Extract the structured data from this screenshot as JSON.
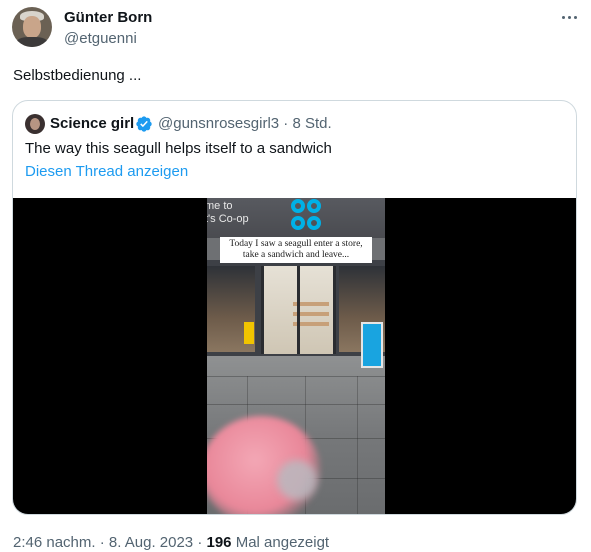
{
  "author": {
    "name": "Günter Born",
    "handle": "@etguenni"
  },
  "tweet": {
    "text": "Selbstbedienung ..."
  },
  "quoted_tweet": {
    "name": "Science girl",
    "handle_time": "@gunsnrosesgirl3 · 8 Std.",
    "text": "The way this seagull helps itself to a sandwich",
    "show_thread_link": "Diesen Thread anzeigen",
    "verified_color": "#1d9bf0",
    "video_frame": {
      "sign_text_line1": "me to",
      "sign_text_line2": "t's Co-op",
      "caption_line1": "Today I saw a seagull enter a store,",
      "caption_line2": "take a sandwich and leave..."
    }
  },
  "footer": {
    "time": "2:46 nachm.",
    "separator1": " · ",
    "date": "8. Aug. 2023",
    "separator2": " · ",
    "views_count": "196",
    "views_label": " Mal angezeigt"
  },
  "icons": {
    "more": "more-horizontal-icon",
    "verified": "verified-badge-icon"
  },
  "colors": {
    "text_primary": "#0f1419",
    "text_secondary": "#536471",
    "link": "#1d9bf0",
    "border": "#cfd9de",
    "coop_blue": "#00b1e7"
  }
}
